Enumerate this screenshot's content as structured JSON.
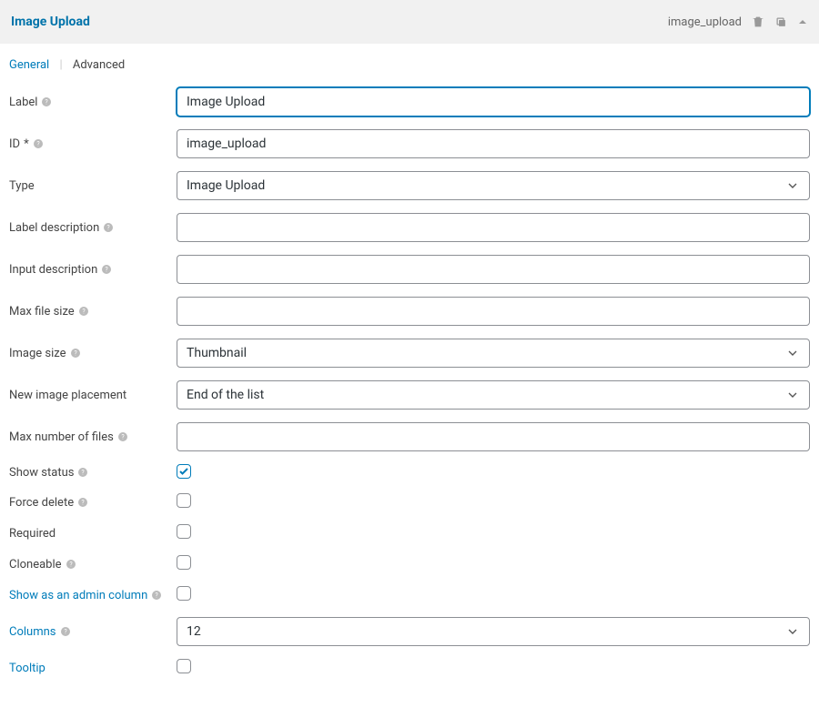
{
  "header": {
    "title": "Image Upload",
    "slug": "image_upload"
  },
  "tabs": {
    "general": "General",
    "advanced": "Advanced"
  },
  "fields": {
    "label": {
      "label": "Label",
      "value": "Image Upload"
    },
    "id": {
      "label": "ID",
      "star": "*",
      "value": "image_upload"
    },
    "type": {
      "label": "Type",
      "value": "Image Upload"
    },
    "label_desc": {
      "label": "Label description",
      "value": ""
    },
    "input_desc": {
      "label": "Input description",
      "value": ""
    },
    "max_file_size": {
      "label": "Max file size",
      "value": ""
    },
    "image_size": {
      "label": "Image size",
      "value": "Thumbnail"
    },
    "new_image_placement": {
      "label": "New image placement",
      "value": "End of the list"
    },
    "max_num_files": {
      "label": "Max number of files",
      "value": ""
    },
    "show_status": {
      "label": "Show status"
    },
    "force_delete": {
      "label": "Force delete"
    },
    "required": {
      "label": "Required"
    },
    "cloneable": {
      "label": "Cloneable"
    },
    "show_admin_col": {
      "label": "Show as an admin column"
    },
    "columns": {
      "label": "Columns",
      "value": "12"
    },
    "tooltip": {
      "label": "Tooltip"
    }
  }
}
